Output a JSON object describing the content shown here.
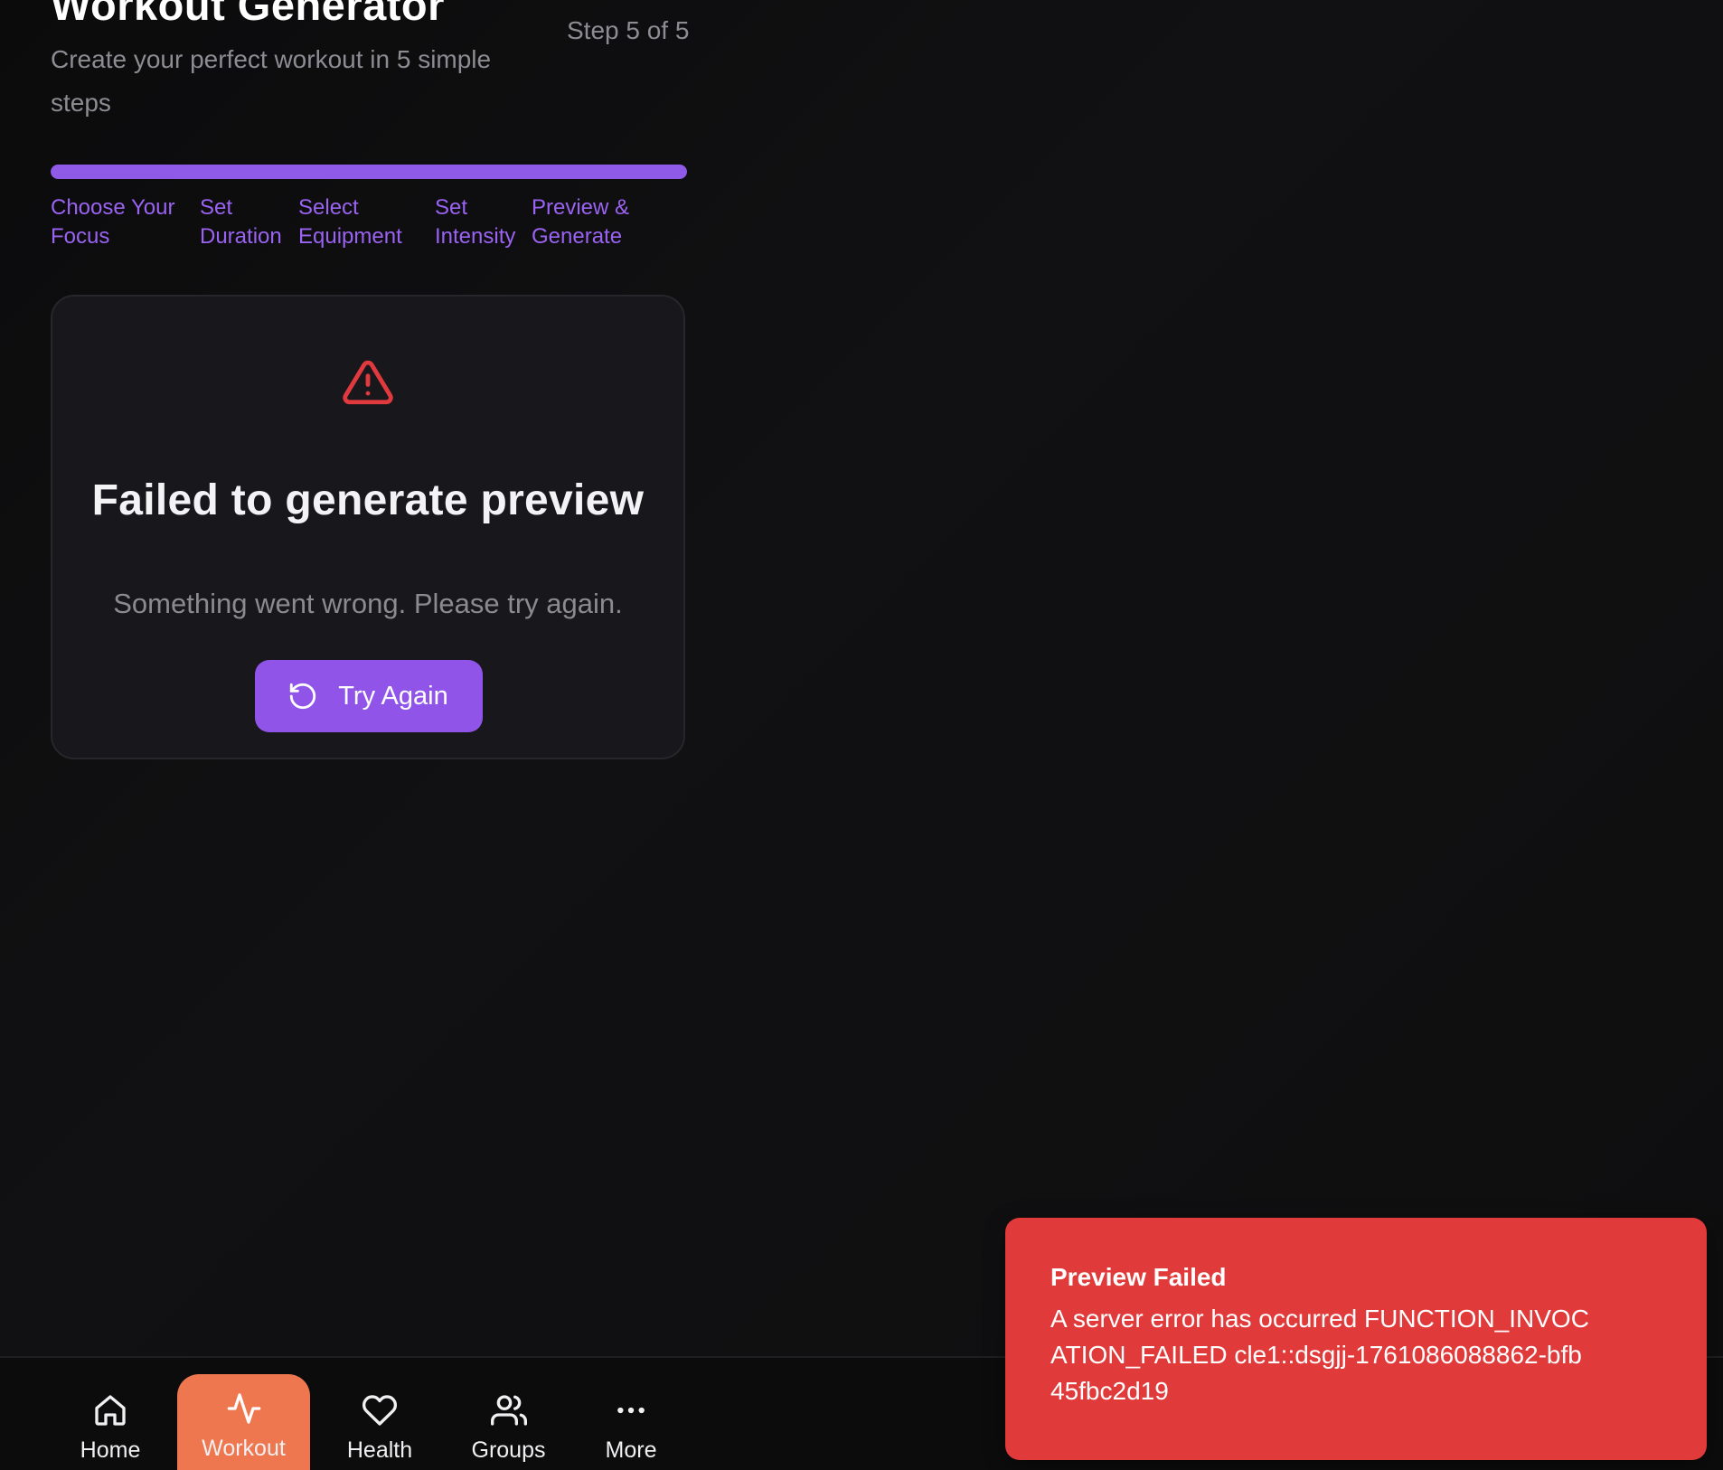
{
  "header": {
    "title": "Workout Generator",
    "subtitle": "Create your perfect workout in 5 simple steps",
    "step_indicator": "Step 5 of 5"
  },
  "progress": {
    "percent": 100,
    "color": "#8f5ae8"
  },
  "steps": [
    {
      "label": "Choose Your Focus"
    },
    {
      "label": "Set Duration"
    },
    {
      "label": "Select Equipment"
    },
    {
      "label": "Set Intensity"
    },
    {
      "label": "Preview & Generate"
    }
  ],
  "error_card": {
    "icon": "warning-triangle-icon",
    "title": "Failed to generate preview",
    "message": "Something went wrong. Please try again.",
    "retry_label": "Try Again",
    "retry_icon": "rotate-ccw-icon"
  },
  "bottom_nav": {
    "items": [
      {
        "label": "Home",
        "icon": "home-icon",
        "active": false
      },
      {
        "label": "Workout",
        "icon": "activity-icon",
        "active": true
      },
      {
        "label": "Health",
        "icon": "heart-icon",
        "active": false
      },
      {
        "label": "Groups",
        "icon": "users-icon",
        "active": false
      },
      {
        "label": "More",
        "icon": "more-horizontal-icon",
        "active": false
      }
    ],
    "active_color": "#ef7750"
  },
  "toast": {
    "title": "Preview Failed",
    "message": "A server error has occurred FUNCTION_INVOCATION_FAILED cle1::dsgjj-1761086088862-bfb45fbc2d19",
    "color": "#e03a3a"
  },
  "colors": {
    "accent": "#9055e8",
    "error": "#e03a3a",
    "background": "#0d0d0e"
  }
}
